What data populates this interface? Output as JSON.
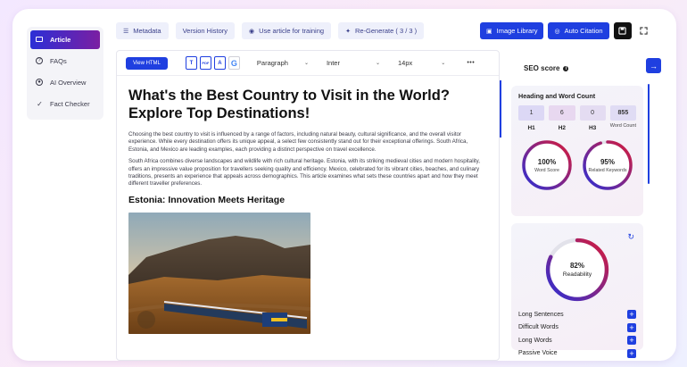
{
  "sidebar": {
    "items": [
      {
        "label": "Article",
        "active": true,
        "icon": "article-icon"
      },
      {
        "label": "FAQs",
        "active": false,
        "icon": "question-circle-icon"
      },
      {
        "label": "AI Overview",
        "active": false,
        "icon": "overview-icon"
      },
      {
        "label": "Fact Checker",
        "active": false,
        "icon": "check-icon"
      }
    ]
  },
  "toolbar": {
    "metadata_label": "Metadata",
    "version_history_label": "Version History",
    "use_for_training_label": "Use article for training",
    "regenerate_label": "Re-Generate ( 3 / 3 )",
    "image_library_label": "Image Library",
    "auto_citation_label": "Auto Citation"
  },
  "editor": {
    "view_html_label": "View HTML",
    "format_icons": [
      "T",
      "PDF",
      "A",
      "G"
    ],
    "paragraph_style": "Paragraph",
    "font_family": "Inter",
    "font_size": "14px",
    "more_label": "•••",
    "title": "What's the Best Country to Visit in the World? Explore Top Destinations!",
    "paragraph1": "Choosing the best country to visit is influenced by a range of factors, including natural beauty, cultural significance, and the overall visitor experience. While every destination offers its unique appeal, a select few consistently stand out for their exceptional offerings. South Africa, Estonia, and Mexico are leading examples, each providing a distinct perspective on travel excellence.",
    "paragraph2": "South Africa combines diverse landscapes and wildlife with rich cultural heritage. Estonia, with its striking medieval cities and modern hospitality, offers an impressive value proposition for travellers seeking quality and efficiency. Mexico, celebrated for its vibrant cities, beaches, and culinary traditions, presents an experience that appeals across demographics. This article examines what sets these countries apart and how they meet different traveller preferences.",
    "heading2": "Estonia: Innovation Meets Heritage"
  },
  "seo": {
    "title": "SEO score",
    "heading_card_title": "Heading and Word Count",
    "counts": [
      {
        "value": "1",
        "label": "H1",
        "color": "#dcd8f5"
      },
      {
        "value": "6",
        "label": "H2",
        "color": "#e8d8f0"
      },
      {
        "value": "0",
        "label": "H3",
        "color": "#e4dcf2"
      },
      {
        "value": "855",
        "label": "Word Count",
        "color": "#e0dcf4"
      }
    ],
    "word_score": {
      "value": "100%",
      "label": "Word Score",
      "fraction": 1.0
    },
    "related_keywords": {
      "value": "95%",
      "label": "Related Keywords",
      "fraction": 0.95
    },
    "readability": {
      "value": "82%",
      "label": "Readability",
      "fraction": 0.82
    },
    "issues": [
      {
        "label": "Long Sentences"
      },
      {
        "label": "Difficult Words"
      },
      {
        "label": "Long Words"
      },
      {
        "label": "Passive Voice"
      }
    ],
    "colors": {
      "accent": "#1f3fe0",
      "ring_start": "#2b2fd6",
      "ring_end": "#d81b3a"
    }
  }
}
